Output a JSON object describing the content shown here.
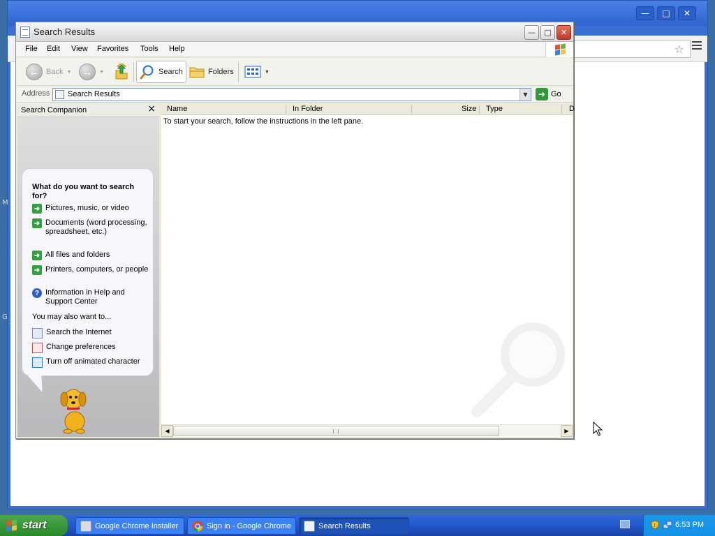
{
  "chrome_window": {
    "edge_chars": [
      "M",
      "G"
    ]
  },
  "explorer": {
    "title": "Search Results",
    "menu": [
      "File",
      "Edit",
      "View",
      "Favorites",
      "Tools",
      "Help"
    ],
    "toolbar": {
      "back": "Back",
      "search": "Search",
      "folders": "Folders"
    },
    "address": {
      "label": "Address",
      "value": "Search Results",
      "go": "Go"
    },
    "companion": {
      "title": "Search Companion",
      "question": "What do you want to search for?",
      "options": [
        "Pictures, music, or video",
        "Documents (word processing, spreadsheet, etc.)",
        "All files and folders",
        "Printers, computers, or people",
        "Information in Help and Support Center"
      ],
      "also_heading": "You may also want to...",
      "also_options": [
        "Search the Internet",
        "Change preferences",
        "Turn off animated character"
      ]
    },
    "columns": [
      "Name",
      "In Folder",
      "Size",
      "Type",
      "D"
    ],
    "instruction": "To start your search, follow the instructions in the left pane."
  },
  "taskbar": {
    "start": "start",
    "tasks": [
      {
        "label": "Google Chrome Installer",
        "active": false
      },
      {
        "label": "Sign in - Google Chrome",
        "active": false
      },
      {
        "label": "Search Results",
        "active": true
      }
    ],
    "clock": "6:53 PM"
  },
  "colors": {
    "desktop_blue": "#3a6ea5",
    "taskbar_blue": "#245cd0",
    "start_green": "#2b8a2b",
    "arrow_green": "#30a041"
  }
}
